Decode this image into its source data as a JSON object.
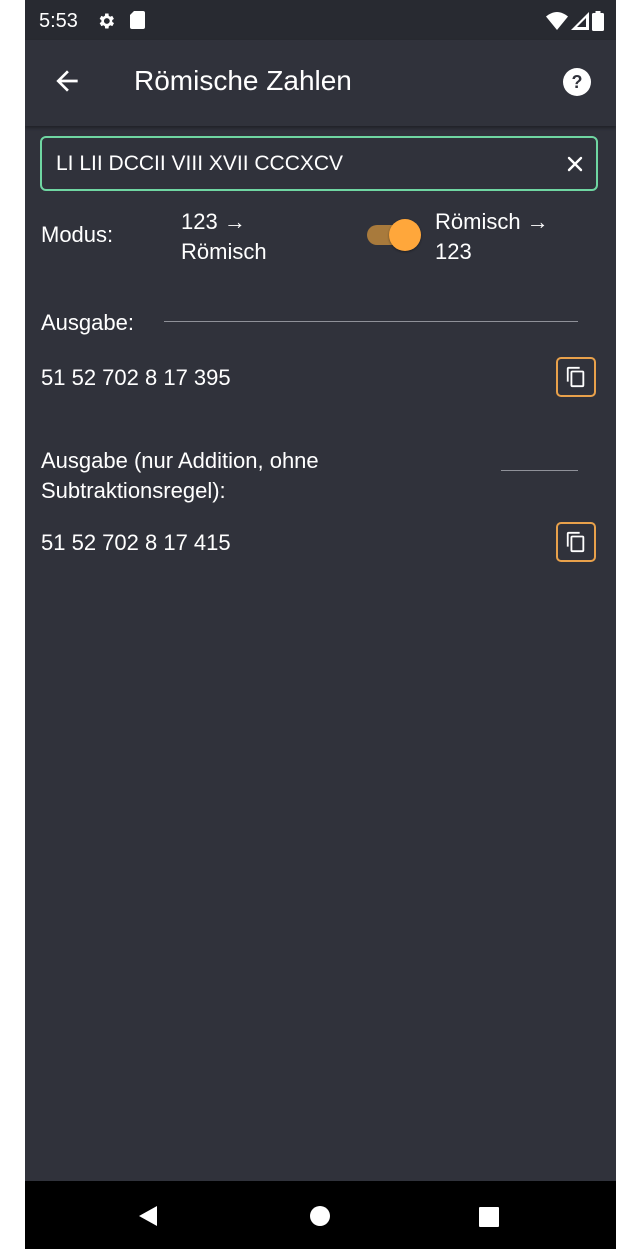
{
  "status_bar": {
    "time": "5:53",
    "icons": [
      "gear-icon",
      "sd-card-icon",
      "wifi-icon",
      "signal-icon",
      "battery-icon"
    ]
  },
  "app_bar": {
    "title": "Römische Zahlen",
    "back_icon": "arrow-left-icon",
    "help_icon": "help-circle-icon"
  },
  "input": {
    "value": "LI LII DCCII VIII XVII CCCXCV",
    "clear_icon": "close-icon"
  },
  "mode": {
    "label": "Modus:",
    "left_line1": "123 →",
    "left_line2": "Römisch",
    "right_line1": "Römisch →",
    "right_line2": "123",
    "toggle_on": true
  },
  "output": {
    "label": "Ausgabe:",
    "value": "51 52 702 8 17 395",
    "copy_icon": "copy-icon"
  },
  "output_addition": {
    "label_line1": "Ausgabe (nur Addition, ohne",
    "label_line2": "Subtraktionsregel):",
    "value": "51 52 702 8 17 415",
    "copy_icon": "copy-icon"
  },
  "nav_bar": {
    "icons": [
      "nav-back-icon",
      "nav-home-icon",
      "nav-recents-icon"
    ]
  },
  "colors": {
    "background": "#30323b",
    "status_bar": "#282a31",
    "input_border": "#6fd6a2",
    "accent": "#ffa73b",
    "copy_border": "#e8a14b"
  }
}
